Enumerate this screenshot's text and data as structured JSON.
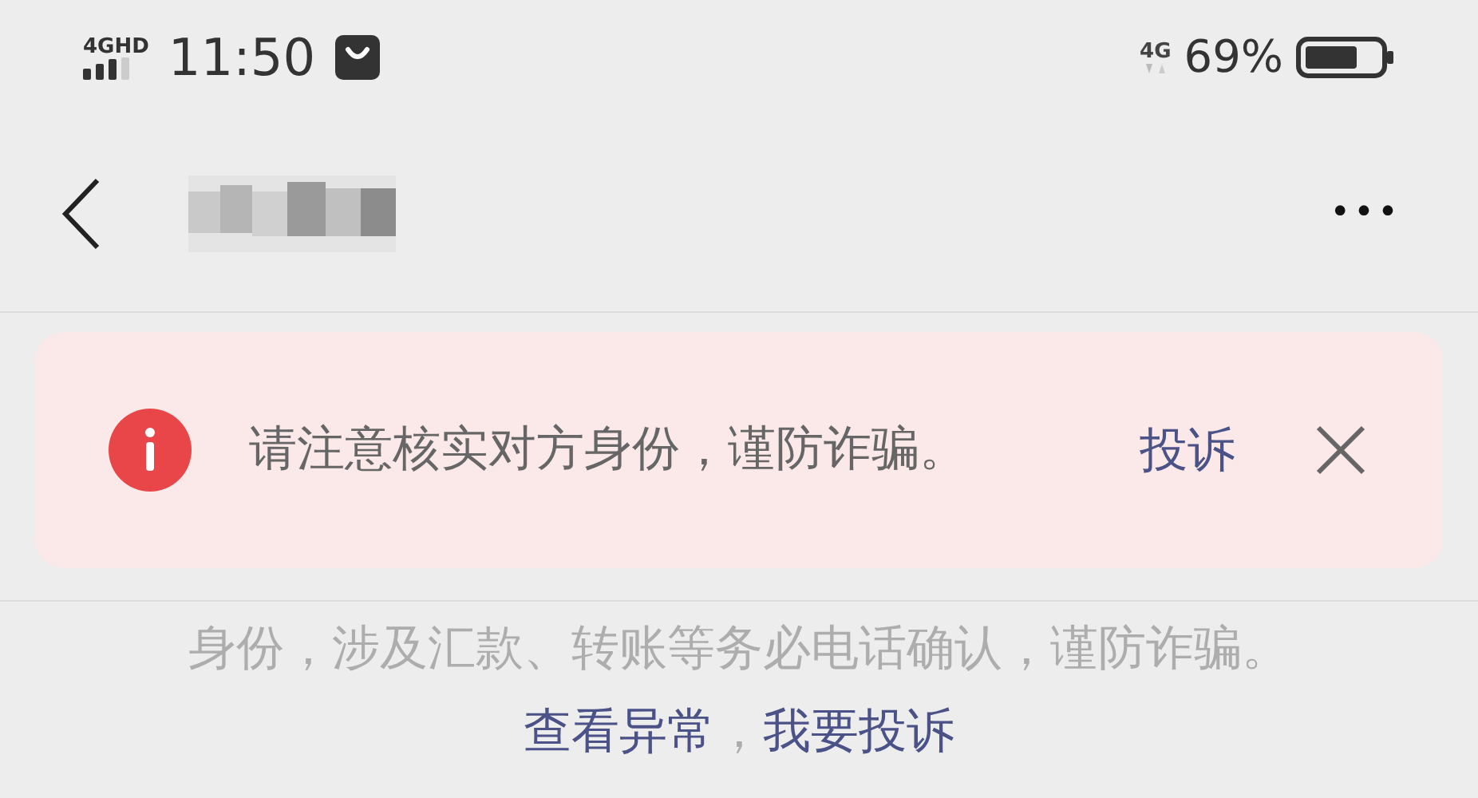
{
  "status_bar": {
    "network": "4GHD",
    "time": "11:50",
    "mobile_data": "4G",
    "battery": "69%"
  },
  "nav_bar": {
    "more": "•••"
  },
  "warning_banner": {
    "message": "请注意核实对方身份，谨防诈骗。",
    "action": "投诉"
  },
  "notice": {
    "text": "身份，涉及汇款、转账等务必电话确认，谨防诈骗。",
    "links": [
      {
        "text": "查看异常"
      },
      {
        "text": "我要投诉"
      }
    ],
    "separator": "，"
  }
}
